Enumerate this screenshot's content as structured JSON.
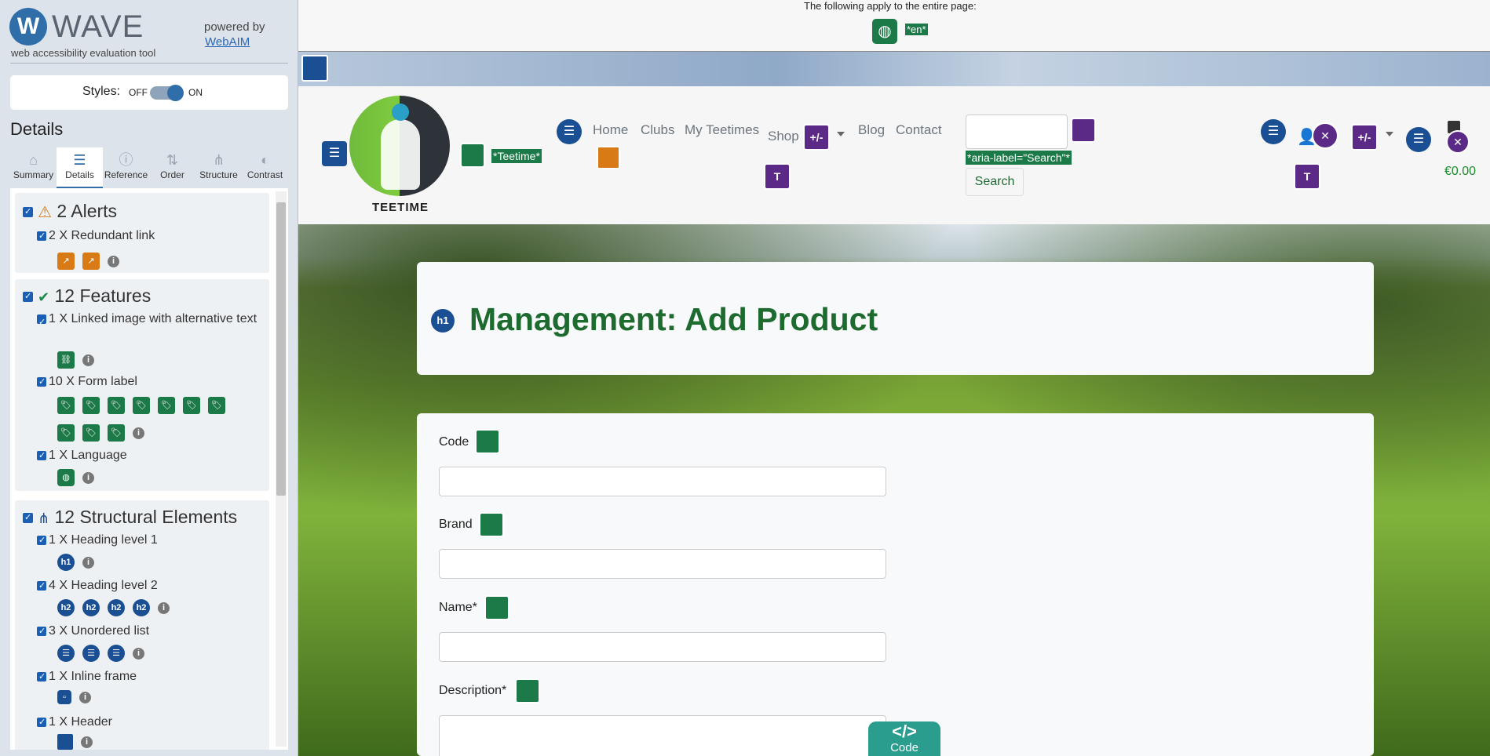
{
  "wave": {
    "logo_letter": "W",
    "title": "WAVE",
    "subtitle": "web accessibility evaluation tool",
    "powered_by": "powered by",
    "webaim": "WebAIM",
    "styles_label": "Styles:",
    "styles_off": "OFF",
    "styles_on": "ON",
    "details_heading": "Details",
    "tabs": [
      {
        "label": "Summary",
        "icon": "home-icon"
      },
      {
        "label": "Details",
        "icon": "list-icon"
      },
      {
        "label": "Reference",
        "icon": "info-icon"
      },
      {
        "label": "Order",
        "icon": "order-icon"
      },
      {
        "label": "Structure",
        "icon": "structure-icon"
      },
      {
        "label": "Contrast",
        "icon": "contrast-icon"
      }
    ],
    "alerts": {
      "heading": "2 Alerts",
      "items": [
        {
          "label": "2 X Redundant link"
        }
      ]
    },
    "features": {
      "heading": "12 Features",
      "items": [
        {
          "label": "1 X Linked image with alternative text"
        },
        {
          "label": "10 X Form label"
        },
        {
          "label": "1 X Language"
        }
      ]
    },
    "structure": {
      "heading": "12 Structural Elements",
      "items": [
        {
          "label": "1 X Heading level 1"
        },
        {
          "label": "4 X Heading level 2"
        },
        {
          "label": "3 X Unordered list"
        },
        {
          "label": "1 X Inline frame"
        },
        {
          "label": "1 X Header"
        }
      ]
    }
  },
  "page": {
    "lang_note": "The following apply to the entire page:",
    "lang_tag": "*en*",
    "logo_text": "TEETIME",
    "teetime_tag": "*Teetime*",
    "nav": [
      "Home",
      "Clubs",
      "My Teetimes",
      "Shop",
      "Blog",
      "Contact"
    ],
    "aria_search_tag": "*aria-label=\"Search\"*",
    "search_button": "Search",
    "cart_total": "€0.00",
    "plus_minus": "+/-",
    "card_title": "Management: Add Product",
    "h1_badge": "h1",
    "fields": [
      {
        "label": "Code"
      },
      {
        "label": "Brand"
      },
      {
        "label": "Name*"
      },
      {
        "label": "Description*"
      }
    ],
    "code_btn_symbol": "</>",
    "code_btn_label": "Code"
  },
  "colors": {
    "wave_blue": "#2f6ea8",
    "feature_green": "#1b7a47",
    "structure_navy": "#1a4f93",
    "aria_purple": "#5b2a86",
    "alert_orange": "#d87a16",
    "heading_green": "#1e6b30"
  }
}
